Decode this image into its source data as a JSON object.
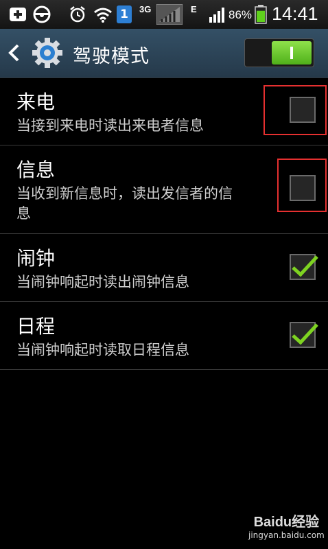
{
  "status_bar": {
    "carrier_badge": "1",
    "network": "3G",
    "network2": "E",
    "battery_percent": "86%",
    "time": "14:41",
    "battery_level": 0.86
  },
  "action_bar": {
    "title": "驾驶模式",
    "master_switch_on": true
  },
  "settings": [
    {
      "title": "来电",
      "subtitle": "当接到来电时读出来电者信息",
      "checked": false
    },
    {
      "title": "信息",
      "subtitle_line1": "当收到新信息时，读出发信者的信",
      "subtitle_line2": "息",
      "checked": false
    },
    {
      "title": "闹钟",
      "subtitle": "当闹钟响起时读出闹钟信息",
      "checked": true
    },
    {
      "title": "日程",
      "subtitle": "当闹钟响起时读取日程信息",
      "checked": true
    }
  ],
  "watermark": {
    "brand": "Baidu经验",
    "url": "jingyan.baidu.com"
  },
  "colors": {
    "check": "#7ed321",
    "highlight": "#e53030",
    "accent": "#5aa9e6"
  }
}
